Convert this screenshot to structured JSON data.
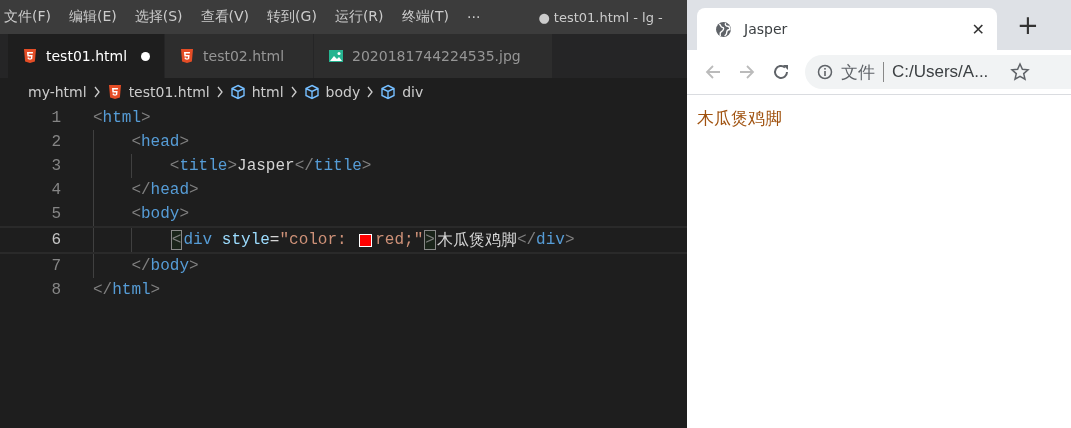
{
  "menu": [
    "文件(F)",
    "编辑(E)",
    "选择(S)",
    "查看(V)",
    "转到(G)",
    "运行(R)",
    "终端(T)",
    "···"
  ],
  "window_title": "● test01.html - lg -",
  "tabs": [
    {
      "label": "test01.html",
      "kind": "html",
      "selected": true,
      "dirty": true
    },
    {
      "label": "test02.html",
      "kind": "html",
      "selected": false,
      "dirty": false
    },
    {
      "label": "2020181744224535.jpg",
      "kind": "image",
      "selected": false,
      "dirty": false
    }
  ],
  "breadcrumb": [
    {
      "label": "my-html",
      "kind": "folder"
    },
    {
      "label": "test01.html",
      "kind": "html"
    },
    {
      "label": "html",
      "kind": "element"
    },
    {
      "label": "body",
      "kind": "element"
    },
    {
      "label": "div",
      "kind": "element"
    }
  ],
  "code": [
    {
      "number": "1",
      "current": false,
      "tokens": [
        {
          "t": "<",
          "kind": "punct"
        },
        {
          "t": "html",
          "kind": "tag"
        },
        {
          "t": ">",
          "kind": "punct"
        }
      ],
      "children": [
        {
          "number": "2",
          "current": false,
          "tokens": [
            {
              "t": "<",
              "kind": "punct"
            },
            {
              "t": "head",
              "kind": "tag"
            },
            {
              "t": ">",
              "kind": "punct"
            }
          ],
          "children": [
            {
              "number": "3",
              "current": false,
              "tokens": [
                {
                  "t": "<",
                  "kind": "punct"
                },
                {
                  "t": "title",
                  "kind": "tag"
                },
                {
                  "t": ">",
                  "kind": "punct"
                },
                {
                  "t": "Jasper",
                  "kind": "text"
                },
                {
                  "t": "</",
                  "kind": "punct"
                },
                {
                  "t": "title",
                  "kind": "tag"
                },
                {
                  "t": ">",
                  "kind": "punct"
                }
              ]
            }
          ]
        },
        {
          "number": "4",
          "current": false,
          "tokens": [
            {
              "t": "</",
              "kind": "punct"
            },
            {
              "t": "head",
              "kind": "tag"
            },
            {
              "t": ">",
              "kind": "punct"
            }
          ]
        },
        {
          "number": "5",
          "current": false,
          "tokens": [
            {
              "t": "<",
              "kind": "punct"
            },
            {
              "t": "body",
              "kind": "tag"
            },
            {
              "t": ">",
              "kind": "punct"
            }
          ],
          "children": [
            {
              "number": "6",
              "current": true,
              "tokens": [
                {
                  "t": "<",
                  "kind": "bracket"
                },
                {
                  "t": "div",
                  "kind": "tag"
                },
                {
                  "t": " style",
                  "kind": "attr"
                },
                {
                  "t": "=",
                  "kind": "text"
                },
                {
                  "t": "\"color: ",
                  "kind": "str"
                },
                {
                  "kind": "swatch",
                  "color": "#ff0000"
                },
                {
                  "t": "red;\"",
                  "kind": "str"
                },
                {
                  "t": ">",
                  "kind": "bracket"
                },
                {
                  "t": "木瓜煲鸡脚",
                  "kind": "text"
                },
                {
                  "t": "</",
                  "kind": "punct"
                },
                {
                  "t": "div",
                  "kind": "tag"
                },
                {
                  "t": ">",
                  "kind": "punct"
                }
              ]
            }
          ]
        },
        {
          "number": "7",
          "current": false,
          "tokens": [
            {
              "t": "</",
              "kind": "punct"
            },
            {
              "t": "body",
              "kind": "tag"
            },
            {
              "t": ">",
              "kind": "punct"
            }
          ]
        }
      ]
    },
    {
      "number": "8",
      "current": false,
      "tokens": [
        {
          "t": "</",
          "kind": "punct"
        },
        {
          "t": "html",
          "kind": "tag"
        },
        {
          "t": ">",
          "kind": "punct"
        }
      ]
    }
  ],
  "browser": {
    "tab_title": "Jasper",
    "close": "✕",
    "new_tab": "+",
    "address_label": "文件",
    "address": "C:/Users/A...",
    "page_text": "木瓜煲鸡脚"
  }
}
